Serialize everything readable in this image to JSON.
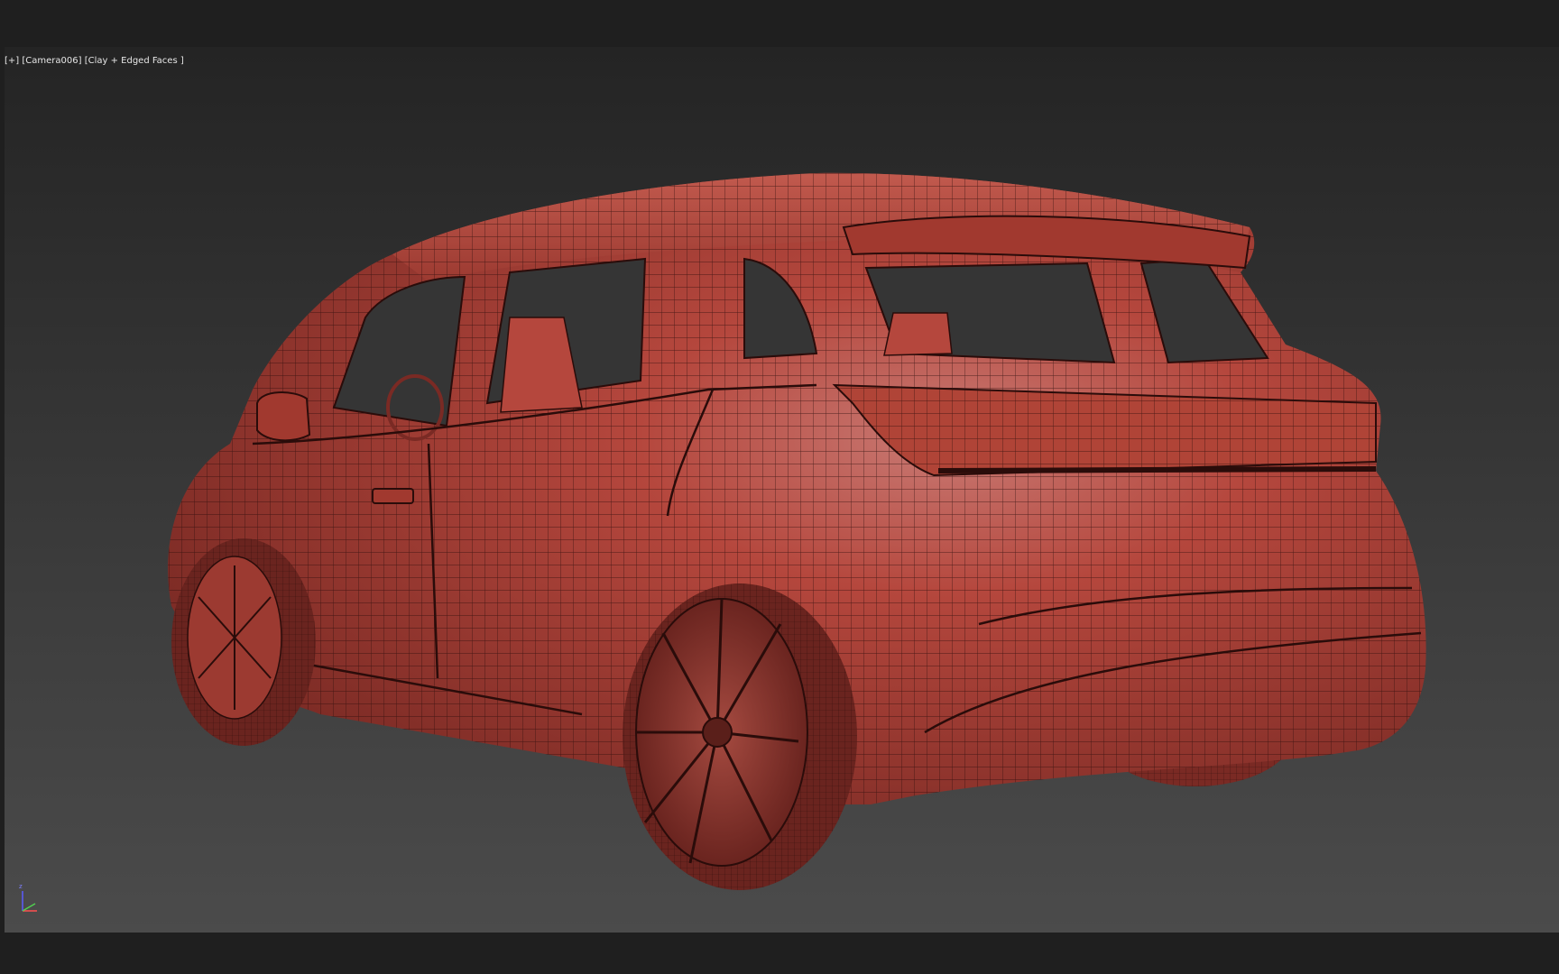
{
  "viewport": {
    "label_plus": "[+]",
    "label_camera": "[Camera006]",
    "label_shading": "[Clay + Edged Faces ]",
    "colors": {
      "clay": "#b5473d",
      "clay_dark": "#7a2a24",
      "wire": "#2a0c0a",
      "bg_top": "#242424",
      "bg_bottom": "#4b4b4b"
    }
  },
  "gizmo": {
    "z_label": "z",
    "icons": [
      "axis-z-icon",
      "axis-x-icon",
      "axis-y-icon"
    ]
  }
}
